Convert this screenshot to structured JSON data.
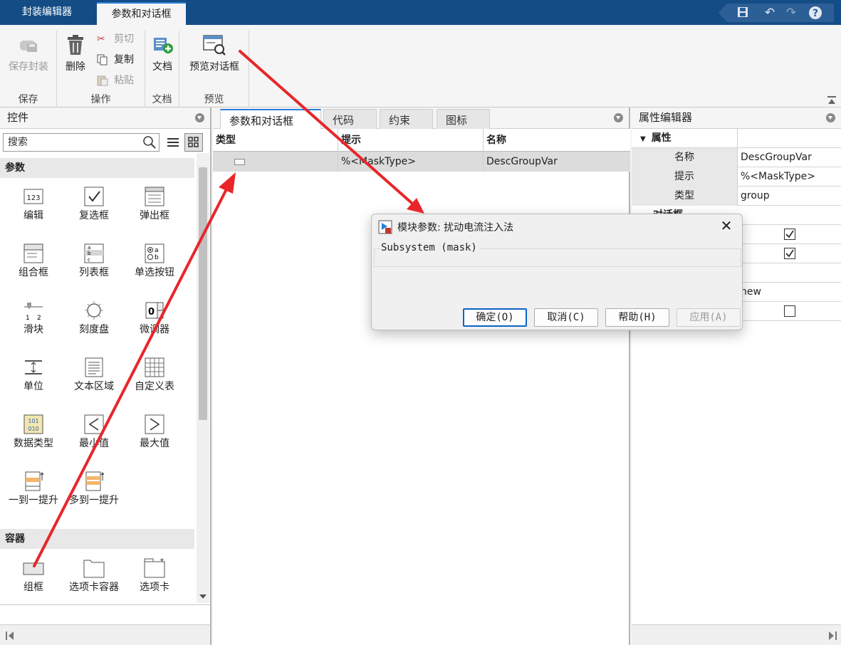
{
  "top_tabs": [
    "封装编辑器",
    "参数和对话框"
  ],
  "ribbon": {
    "save_mask": "保存封装",
    "delete": "删除",
    "cut": "剪切",
    "copy": "复制",
    "paste": "粘贴",
    "document": "文档",
    "preview_dialog": "预览对话框",
    "sections": [
      "保存",
      "操作",
      "文档",
      "预览"
    ]
  },
  "controls_pane": {
    "title": "控件",
    "search_placeholder": "搜索",
    "category_params": "参数",
    "category_containers": "容器",
    "params": [
      "编辑",
      "复选框",
      "弹出框",
      "组合框",
      "列表框",
      "单选按钮",
      "滑块",
      "刻度盘",
      "微调器",
      "单位",
      "文本区域",
      "自定义表",
      "数据类型",
      "最小值",
      "最大值",
      "一到一提升",
      "多到一提升"
    ],
    "containers": [
      "组框",
      "选项卡容器",
      "选项卡"
    ]
  },
  "center_pane": {
    "tabs": [
      "参数和对话框",
      "代码",
      "约束",
      "图标"
    ],
    "columns": [
      "类型",
      "提示",
      "名称"
    ],
    "row": {
      "prompt": "%<MaskType>",
      "name": "DescGroupVar"
    }
  },
  "property_editor": {
    "title": "属性编辑器",
    "group": "属性",
    "name_key": "名称",
    "name_val": "DescGroupVar",
    "prompt_key": "提示",
    "prompt_val": "%<MaskType>",
    "type_key": "类型",
    "type_val": "group",
    "dialog_key_partial": "对话框",
    "value_new": "new"
  },
  "dialog": {
    "title": "模块参数: 扰动电流注入法",
    "group_label": "Subsystem (mask)",
    "ok": "确定(O)",
    "cancel": "取消(C)",
    "help": "帮助(H)",
    "apply": "应用(A)"
  },
  "colors": {
    "titlebar": "#144d86",
    "accent": "#2a7fd5",
    "arrow": "#e8262a"
  }
}
